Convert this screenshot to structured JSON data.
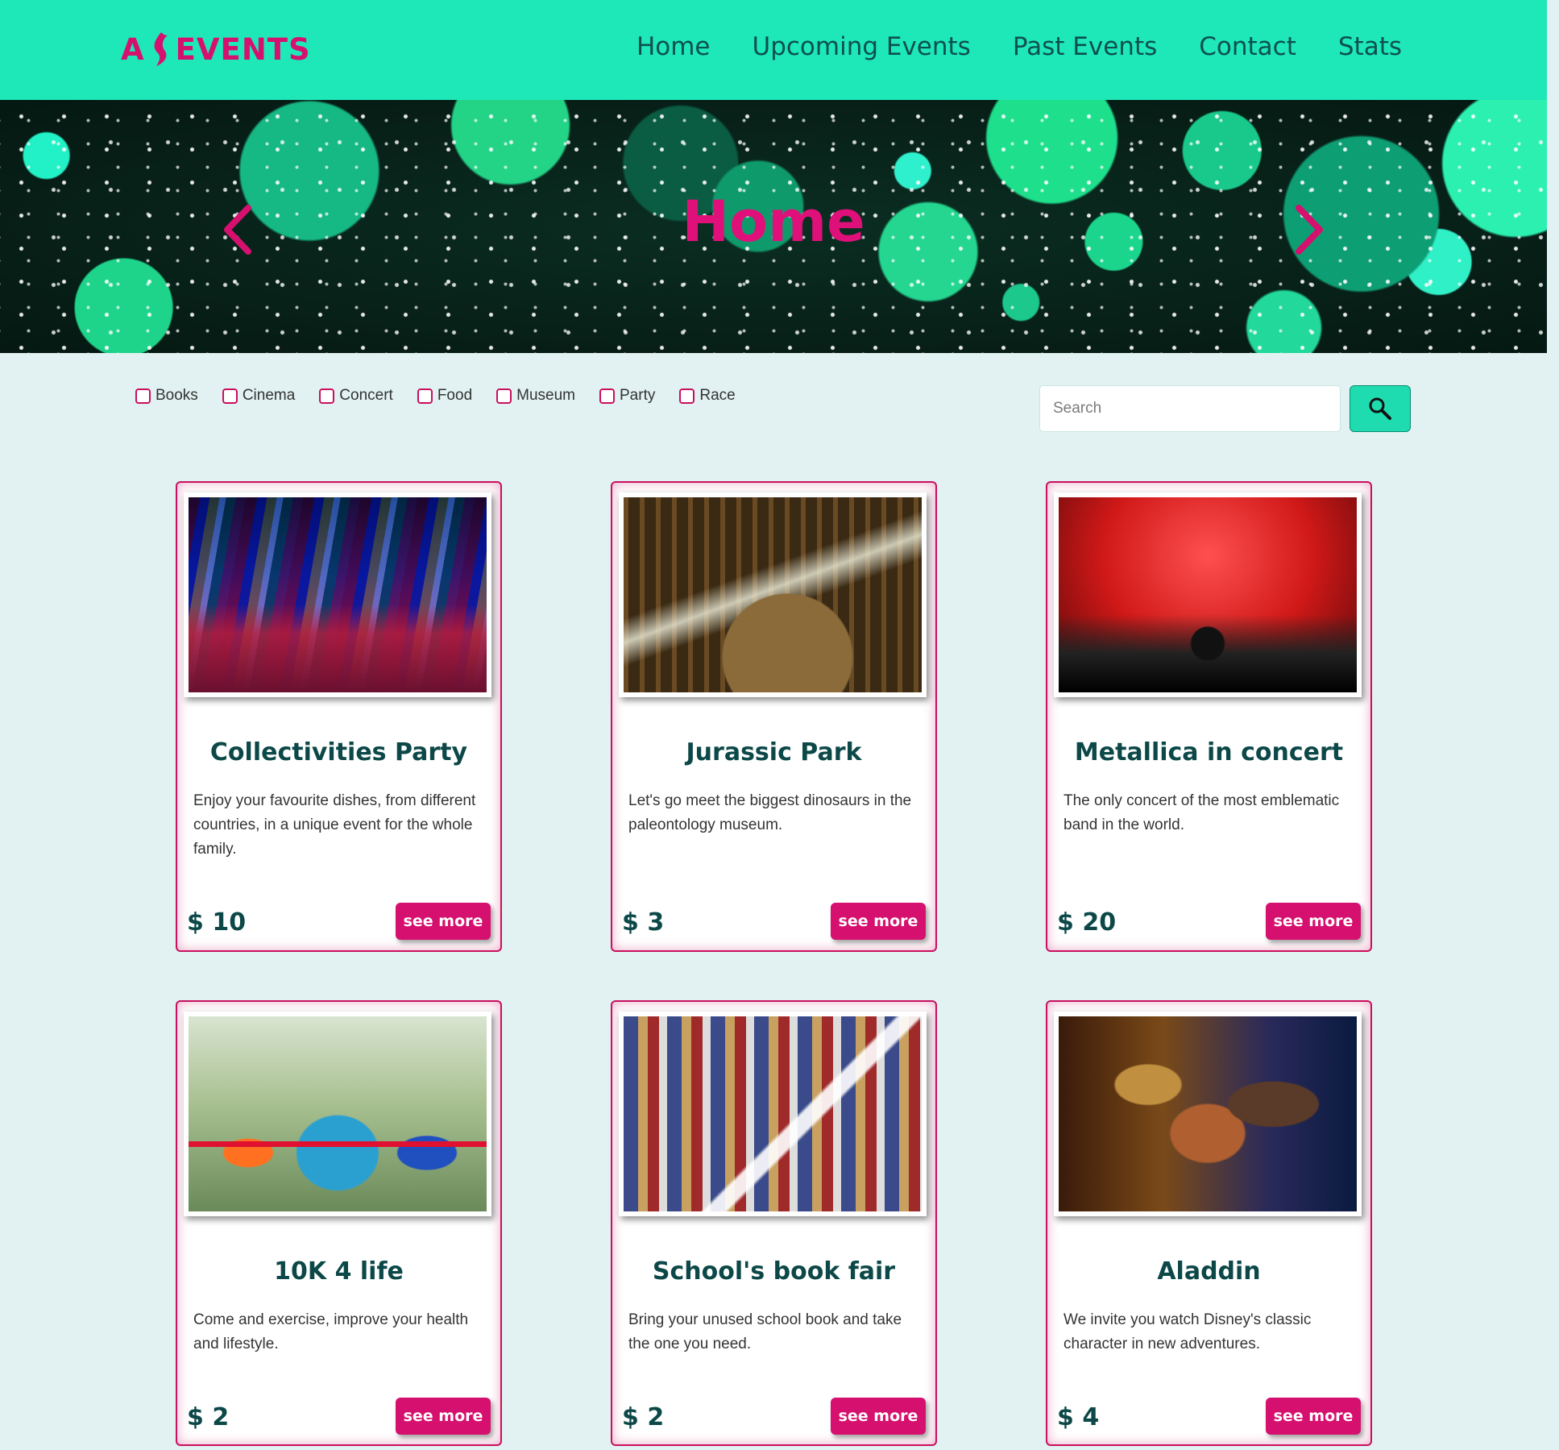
{
  "brand": {
    "logo_text_left": "A",
    "logo_text_right": "EVENTS",
    "accent": "#d6106e",
    "nav_bg": "#1ee8b8"
  },
  "nav": {
    "links": [
      "Home",
      "Upcoming Events",
      "Past Events",
      "Contact",
      "Stats"
    ]
  },
  "hero": {
    "title": "Home",
    "prev_icon": "chevron-left-icon",
    "next_icon": "chevron-right-icon"
  },
  "filters": {
    "categories": [
      "Books",
      "Cinema",
      "Concert",
      "Food",
      "Museum",
      "Party",
      "Race"
    ],
    "checked": [
      false,
      false,
      false,
      false,
      false,
      false,
      false
    ]
  },
  "search": {
    "placeholder": "Search",
    "value": "",
    "button_icon": "search-icon"
  },
  "cards": [
    {
      "title": "Collectivities Party",
      "description": "Enjoy your favourite dishes, from different countries, in a unique event for the whole family.",
      "price": "$ 10",
      "button": "see more"
    },
    {
      "title": "Jurassic Park",
      "description": "Let's go meet the biggest dinosaurs in the paleontology museum.",
      "price": "$ 3",
      "button": "see more"
    },
    {
      "title": "Metallica in concert",
      "description": "The only concert of the most emblematic band in the world.",
      "price": "$ 20",
      "button": "see more"
    },
    {
      "title": "10K 4 life",
      "description": "Come and exercise, improve your health and lifestyle.",
      "price": "$ 2",
      "button": "see more"
    },
    {
      "title": "School's book fair",
      "description": "Bring your unused school book and take the one you need.",
      "price": "$ 2",
      "button": "see more"
    },
    {
      "title": "Aladdin",
      "description": "We invite you watch Disney's classic character in new adventures.",
      "price": "$ 4",
      "button": "see more"
    }
  ]
}
